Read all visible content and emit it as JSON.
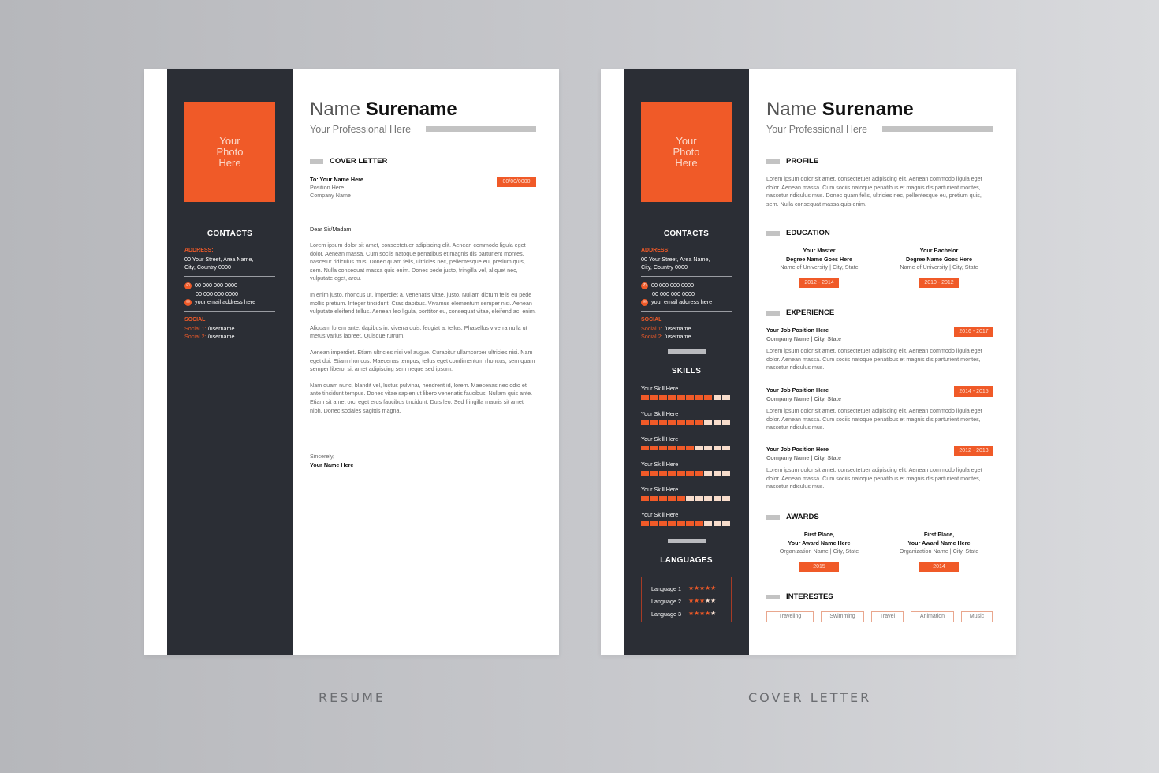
{
  "colors": {
    "accent": "#f05a28",
    "sidebar": "#2b2e35",
    "page": "#ffffff"
  },
  "captions": {
    "left": "RESUME",
    "right": "COVER LETTER"
  },
  "common": {
    "photo_placeholder": "Your\nPhoto\nHere",
    "first_name": "Name",
    "last_name": "Surename",
    "professional": "Your Professional Here",
    "contacts": {
      "title": "CONTACTS",
      "address_label": "ADDRESS:",
      "address_line1": "00 Your Street, Area Name,",
      "address_line2": "City, Country 0000",
      "phone1": "00 000 000 0000",
      "phone2": "00 000 000 0000",
      "email": "your email address here",
      "phone_icon": "phone-icon",
      "email_icon": "mail-icon",
      "social_label": "SOCIAL",
      "social": [
        {
          "label": "Social 1:",
          "value": " /username"
        },
        {
          "label": "Social 2:",
          "value": " /username"
        }
      ]
    }
  },
  "cover_letter": {
    "section_title": "COVER LETTER",
    "to": "To: Your Name Here",
    "position": "Position Here",
    "company": "Company Name",
    "date": "00/00/0000",
    "salutation": "Dear Sir/Madam,",
    "paragraphs": [
      "Lorem ipsum dolor sit amet, consectetuer adipiscing elit. Aenean commodo ligula eget dolor. Aenean massa. Cum sociis natoque penatibus et magnis dis parturient montes, nascetur ridiculus mus. Donec quam felis, ultricies nec, pellentesque eu, pretium quis, sem. Nulla consequat massa quis enim. Donec pede justo, fringilla vel, aliquet nec, vulputate eget, arcu.",
      "In enim justo, rhoncus ut, imperdiet a, venenatis vitae, justo. Nullam dictum felis eu pede mollis pretium. Integer tincidunt. Cras dapibus. Vivamus elementum semper nisi. Aenean vulputate eleifend tellus. Aenean leo ligula, porttitor eu, consequat vitae, eleifend ac, enim.",
      "Aliquam lorem ante, dapibus in, viverra quis, feugiat a, tellus. Phasellus viverra nulla ut metus varius laoreet. Quisque rutrum.",
      "Aenean imperdiet. Etiam ultricies nisi vel augue. Curabitur ullamcorper ultricies nisi. Nam eget dui. Etiam rhoncus. Maecenas tempus, tellus eget condimentum rhoncus, sem quam semper libero, sit amet adipiscing sem neque sed ipsum.",
      "Nam quam nunc, blandit vel, luctus pulvinar, hendrerit id, lorem. Maecenas nec odio et ante tincidunt tempus. Donec vitae sapien ut libero venenatis faucibus. Nullam quis ante. Etiam sit amet orci eget eros faucibus tincidunt. Duis leo. Sed fringilla mauris sit amet nibh. Donec sodales sagittis magna."
    ],
    "closing": "Sincerely,",
    "signature": "Your Name Here"
  },
  "resume": {
    "skills_title": "SKILLS",
    "skills": [
      {
        "label": "Your Skill Here",
        "level": 8,
        "max": 10
      },
      {
        "label": "Your Skill Here",
        "level": 7,
        "max": 10
      },
      {
        "label": "Your Skill Here",
        "level": 6,
        "max": 10
      },
      {
        "label": "Your Skill Here",
        "level": 7,
        "max": 10
      },
      {
        "label": "Your Skill Here",
        "level": 5,
        "max": 10
      },
      {
        "label": "Your Skill Here",
        "level": 7,
        "max": 10
      }
    ],
    "languages_title": "LANGUAGES",
    "languages": [
      {
        "label": "Language 1",
        "stars": 5,
        "max": 5
      },
      {
        "label": "Language 2",
        "stars": 3,
        "max": 5
      },
      {
        "label": "Language 3",
        "stars": 4,
        "max": 5
      }
    ],
    "profile": {
      "title": "PROFILE",
      "text": "Lorem ipsum dolor sit amet, consectetuer adipiscing elit. Aenean commodo ligula eget dolor. Aenean massa. Cum sociis natoque penatibus et magnis dis parturient montes, nascetur ridiculus mus. Donec quam felis, ultricies nec, pellentesque eu, pretium quis, sem. Nulla consequat massa quis enim."
    },
    "education": {
      "title": "EDUCATION",
      "items": [
        {
          "degree_type": "Your Master",
          "degree": "Degree Name Goes Here",
          "school": "Name of University | City, State",
          "years": "2012 - 2014"
        },
        {
          "degree_type": "Your Bachelor",
          "degree": "Degree Name Goes Here",
          "school": "Name of University | City, State",
          "years": "2010 - 2012"
        }
      ]
    },
    "experience": {
      "title": "EXPERIENCE",
      "items": [
        {
          "position": "Your Job Position Here",
          "company": "Company Name | City, State",
          "years": "2016 - 2017",
          "text": "Lorem ipsum dolor sit amet, consectetuer adipiscing elit. Aenean commodo ligula eget dolor. Aenean massa. Cum sociis natoque penatibus et magnis dis parturient montes, nascetur ridiculus mus."
        },
        {
          "position": "Your Job Position Here",
          "company": "Company Name | City, State",
          "years": "2014 - 2015",
          "text": "Lorem ipsum dolor sit amet, consectetuer adipiscing elit. Aenean commodo ligula eget dolor. Aenean massa. Cum sociis natoque penatibus et magnis dis parturient montes, nascetur ridiculus mus."
        },
        {
          "position": "Your Job Position Here",
          "company": "Company Name | City, State",
          "years": "2012 - 2013",
          "text": "Lorem ipsum dolor sit amet, consectetuer adipiscing elit. Aenean commodo ligula eget dolor. Aenean massa. Cum sociis natoque penatibus et magnis dis parturient montes, nascetur ridiculus mus."
        }
      ]
    },
    "awards": {
      "title": "AWARDS",
      "items": [
        {
          "place": "First Place,",
          "name": "Your Award Name Here",
          "org": "Organization Name | City, State",
          "year": "2015"
        },
        {
          "place": "First Place,",
          "name": "Your Award Name Here",
          "org": "Organization Name | City, State",
          "year": "2014"
        }
      ]
    },
    "interests": {
      "title": "INTERESTES",
      "items": [
        "Traveling",
        "Swimming",
        "Travel",
        "Animation",
        "Music"
      ]
    }
  }
}
